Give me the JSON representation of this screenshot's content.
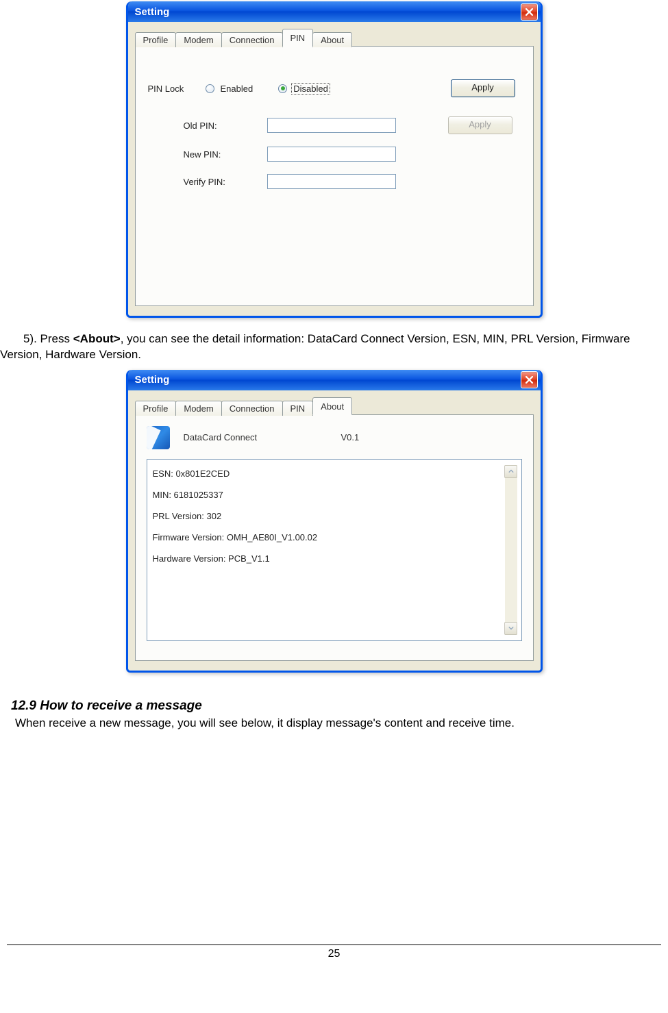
{
  "dialog1": {
    "title": "Setting",
    "tabs": [
      "Profile",
      "Modem",
      "Connection",
      "PIN",
      "About"
    ],
    "active_tab": "PIN",
    "pin": {
      "lock_label": "PIN Lock",
      "enabled_label": "Enabled",
      "disabled_label": "Disabled",
      "selected": "Disabled",
      "apply_label": "Apply",
      "fields": {
        "old_label": "Old PIN:",
        "new_label": "New PIN:",
        "verify_label": "Verify PIN:",
        "old_value": "",
        "new_value": "",
        "verify_value": ""
      },
      "apply2_label": "Apply"
    }
  },
  "doc": {
    "step5_prefix": "5). Press ",
    "step5_bold": "<About>",
    "step5_suffix": ", you can see the detail information: DataCard Connect Version, ESN, MIN, PRL Version, Firmware Version, Hardware Version.",
    "section_heading": "12.9  How to receive a message",
    "section_body": "When receive a new message, you will see below, it display message's content and receive time.",
    "page_number": "25"
  },
  "dialog2": {
    "title": "Setting",
    "tabs": [
      "Profile",
      "Modem",
      "Connection",
      "PIN",
      "About"
    ],
    "active_tab": "About",
    "about": {
      "app_name": "DataCard Connect",
      "version": "V0.1",
      "lines": [
        "ESN: 0x801E2CED",
        "MIN: 6181025337",
        "PRL Version:   302",
        "Firmware Version:   OMH_AE80I_V1.00.02",
        "Hardware Version:   PCB_V1.1"
      ]
    }
  }
}
